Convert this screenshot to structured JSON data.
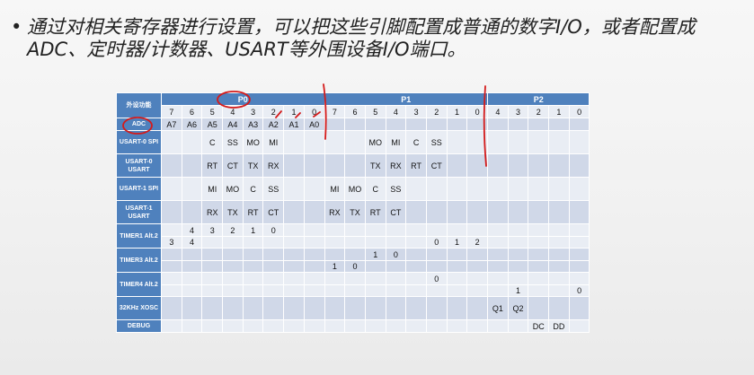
{
  "slide": {
    "bullet": "•",
    "text": "通过对相关寄存器进行设置，可以把这些引脚配置成普通的数字I/O，或者配置成ADC、定时器/计数器、USART等外围设备I/O端口。"
  },
  "table": {
    "header_label": "外设功能",
    "groups": [
      {
        "label": "P0",
        "span": 8
      },
      {
        "label": "P1",
        "span": 8
      },
      {
        "label": "P2",
        "span": 5
      }
    ],
    "pins": [
      "7",
      "6",
      "5",
      "4",
      "3",
      "2",
      "1",
      "0",
      "7",
      "6",
      "5",
      "4",
      "3",
      "2",
      "1",
      "0",
      "4",
      "3",
      "2",
      "1",
      "0"
    ],
    "rows": [
      {
        "label": "ADC",
        "cells": [
          "A7",
          "A6",
          "A5",
          "A4",
          "A3",
          "A2",
          "A1",
          "A0",
          "",
          "",
          "",
          "",
          "",
          "",
          "",
          "",
          "",
          "",
          "",
          "",
          ""
        ]
      },
      {
        "label": "USART-0 SPI",
        "cells": [
          "",
          "",
          "C",
          "SS",
          "MO",
          "MI",
          "",
          "",
          "",
          "",
          "MO",
          "MI",
          "C",
          "SS",
          "",
          "",
          "",
          "",
          "",
          "",
          ""
        ]
      },
      {
        "label": "USART-0 USART",
        "cells": [
          "",
          "",
          "RT",
          "CT",
          "TX",
          "RX",
          "",
          "",
          "",
          "",
          "TX",
          "RX",
          "RT",
          "CT",
          "",
          "",
          "",
          "",
          "",
          "",
          ""
        ]
      },
      {
        "label": "USART-1 SPI",
        "cells": [
          "",
          "",
          "MI",
          "MO",
          "C",
          "SS",
          "",
          "",
          "MI",
          "MO",
          "C",
          "SS",
          "",
          "",
          "",
          "",
          "",
          "",
          "",
          "",
          ""
        ]
      },
      {
        "label": "USART-1 USART",
        "cells": [
          "",
          "",
          "RX",
          "TX",
          "RT",
          "CT",
          "",
          "",
          "RX",
          "TX",
          "RT",
          "CT",
          "",
          "",
          "",
          "",
          "",
          "",
          "",
          "",
          ""
        ]
      },
      {
        "label": "TIMER1 Alt.2",
        "cells": [
          "",
          "4",
          "3",
          "2",
          "1",
          "0",
          "",
          "",
          "",
          "",
          "",
          "",
          "",
          "",
          "",
          "",
          "",
          "",
          "",
          "",
          ""
        ],
        "extra_cells": [
          "3",
          "4",
          "",
          "",
          "",
          "",
          "",
          "",
          "",
          "",
          "",
          "",
          "",
          "0",
          "1",
          "2",
          "",
          "",
          "",
          "",
          ""
        ]
      },
      {
        "label": "TIMER3 Alt.2",
        "cells": [
          "",
          "",
          "",
          "",
          "",
          "",
          "",
          "",
          "",
          "",
          "1",
          "0",
          "",
          "",
          "",
          "",
          "",
          "",
          "",
          "",
          ""
        ],
        "extra_cells": [
          "",
          "",
          "",
          "",
          "",
          "",
          "",
          "",
          "1",
          "0",
          "",
          "",
          "",
          "",
          "",
          "",
          "",
          "",
          "",
          "",
          ""
        ]
      },
      {
        "label": "TIMER4 Alt.2",
        "cells": [
          "",
          "",
          "",
          "",
          "",
          "",
          "",
          "",
          "",
          "",
          "",
          "",
          "",
          "0",
          "",
          "",
          "",
          "",
          "",
          "",
          ""
        ],
        "extra_cells": [
          "",
          "",
          "",
          "",
          "",
          "",
          "",
          "",
          "",
          "",
          "",
          "",
          "",
          "",
          "",
          "",
          "",
          "1",
          "",
          "",
          "0"
        ]
      },
      {
        "label": "32KHz XOSC",
        "cells": [
          "",
          "",
          "",
          "",
          "",
          "",
          "",
          "",
          "",
          "",
          "",
          "",
          "",
          "",
          "",
          "",
          "Q1",
          "Q2",
          "",
          "",
          ""
        ]
      },
      {
        "label": "DEBUG",
        "cells": [
          "",
          "",
          "",
          "",
          "",
          "",
          "",
          "",
          "",
          "",
          "",
          "",
          "",
          "",
          "",
          "",
          "",
          "",
          "DC",
          "DD",
          ""
        ]
      }
    ]
  }
}
